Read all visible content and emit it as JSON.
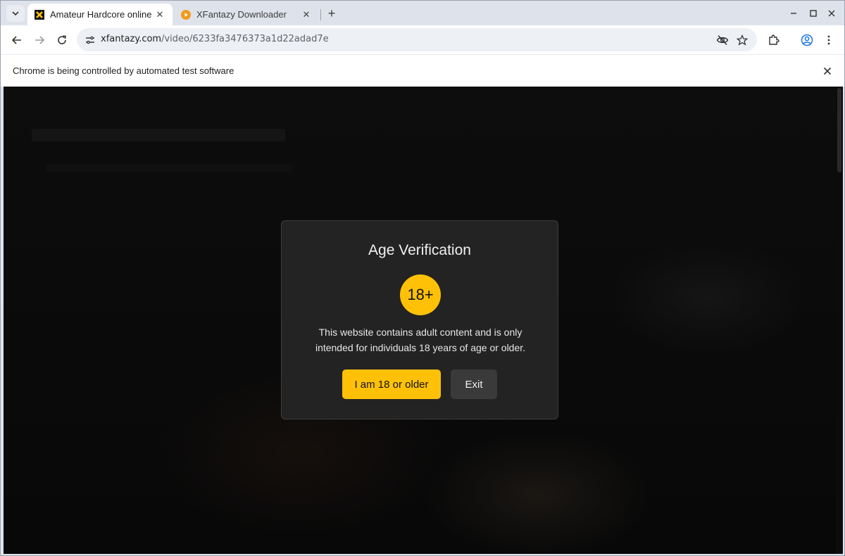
{
  "browser": {
    "tabs": [
      {
        "title": "Amateur Hardcore online",
        "active": true,
        "favicon": "x-logo-icon"
      },
      {
        "title": "XFantazy Downloader",
        "active": false,
        "favicon": "play-circle-icon"
      }
    ],
    "url": {
      "host": "xfantazy.com",
      "path": "/video/6233fa3476373a1d22adad7e"
    },
    "infobar_message": "Chrome is being controlled by automated test software"
  },
  "modal": {
    "title": "Age Verification",
    "badge": "18+",
    "message": "This website contains adult content and is only intended for individuals 18 years of age or older.",
    "confirm_label": "I am 18 or older",
    "exit_label": "Exit",
    "accent_color": "#ffc107"
  }
}
